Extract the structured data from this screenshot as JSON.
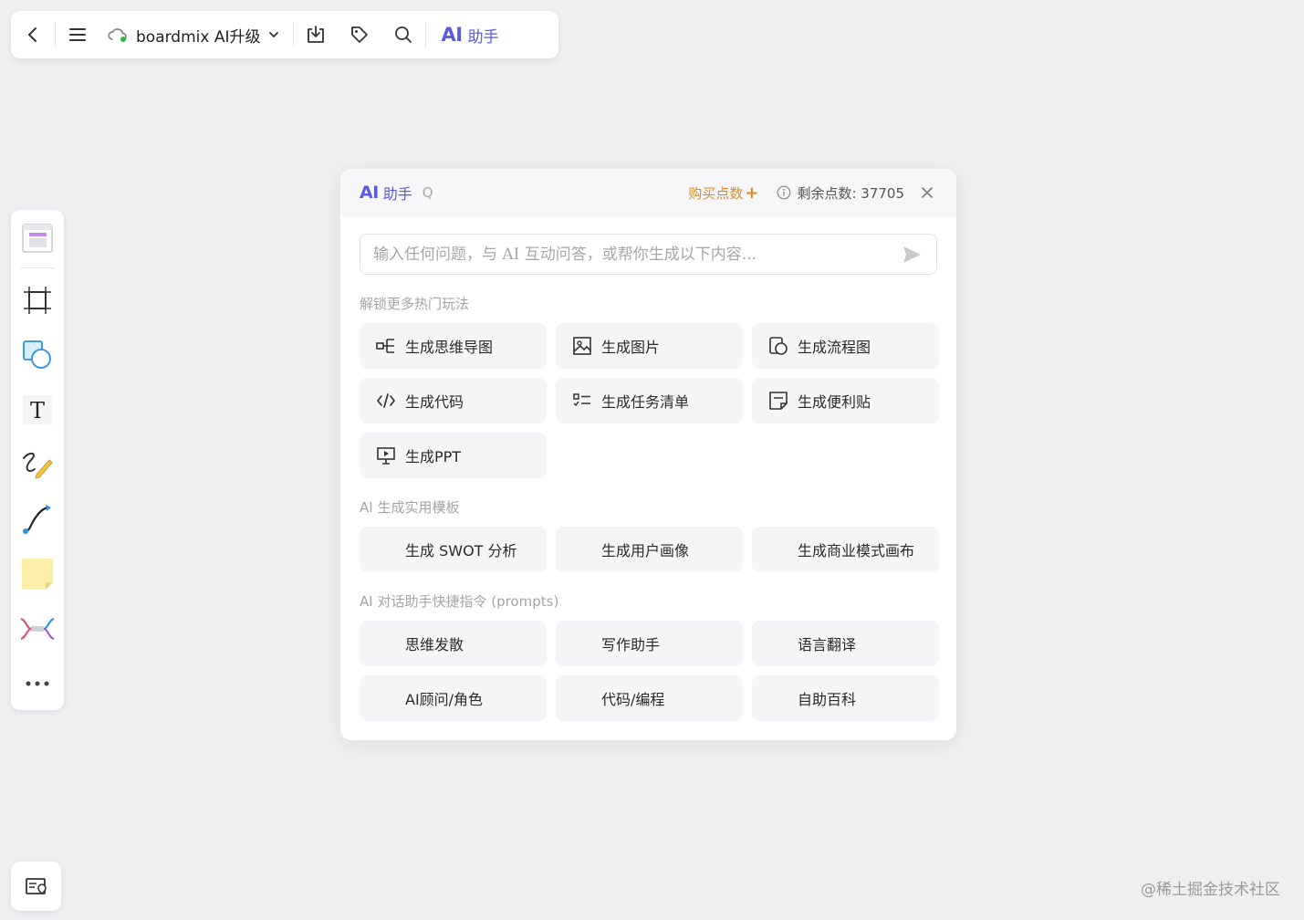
{
  "topbar": {
    "file_name": "boardmix AI升级",
    "ai_mark": "AI",
    "ai_label": "助手"
  },
  "panel": {
    "ai_mark": "AI",
    "title": "助手",
    "title_hint": "Q",
    "buy_points": "购买点数",
    "remaining": "剩余点数: 37705",
    "input_placeholder": "输入任何问题，与 AI 互动问答，或帮你生成以下内容...",
    "sections": {
      "hot": "解锁更多热门玩法",
      "templates": "AI 生成实用模板",
      "prompts": "AI 对话助手快捷指令 (prompts)"
    },
    "hot_items": [
      "生成思维导图",
      "生成图片",
      "生成流程图",
      "生成代码",
      "生成任务清单",
      "生成便利贴",
      "生成PPT"
    ],
    "template_items": [
      "生成 SWOT 分析",
      "生成用户画像",
      "生成商业模式画布"
    ],
    "prompt_items": [
      "思维发散",
      "写作助手",
      "语言翻译",
      "AI顾问/角色",
      "代码/编程",
      "自助百科"
    ]
  },
  "watermark": "@稀土掘金技术社区",
  "colors": {
    "accent": "#5b5be0",
    "buy": "#e08a1c",
    "background": "#efeff1"
  }
}
